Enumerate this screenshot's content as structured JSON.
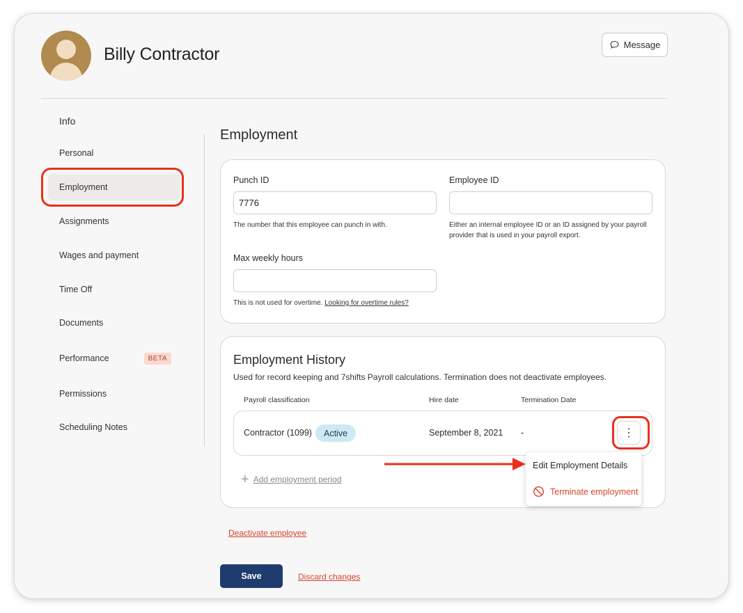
{
  "header": {
    "employee_name": "Billy Contractor",
    "message_label": "Message"
  },
  "sidebar": {
    "heading": "Info",
    "items": [
      {
        "label": "Personal"
      },
      {
        "label": "Employment",
        "active": true
      },
      {
        "label": "Assignments"
      },
      {
        "label": "Wages and payment"
      },
      {
        "label": "Time Off"
      },
      {
        "label": "Documents"
      },
      {
        "label": "Performance",
        "badge": "BETA"
      },
      {
        "label": "Permissions"
      },
      {
        "label": "Scheduling Notes"
      }
    ]
  },
  "employment": {
    "title": "Employment",
    "punch_id": {
      "label": "Punch ID",
      "value": "7776",
      "help": "The number that this employee can punch in with."
    },
    "employee_id": {
      "label": "Employee ID",
      "value": "",
      "help": "Either an internal employee ID or an ID assigned by your payroll provider that is used in your payroll export."
    },
    "max_weekly_hours": {
      "label": "Max weekly hours",
      "value": "",
      "help": "This is not used for overtime.",
      "help_link": "Looking for overtime rules?"
    }
  },
  "history": {
    "title": "Employment History",
    "description": "Used for record keeping and 7shifts Payroll calculations. Termination does not deactivate employees.",
    "columns": [
      "Payroll classification",
      "Hire date",
      "Termination Date"
    ],
    "rows": [
      {
        "classification": "Contractor (1099)",
        "status": "Active",
        "hire_date": "September 8, 2021",
        "termination_date": "-"
      }
    ],
    "add_period_label": "Add employment period",
    "menu": {
      "edit_label": "Edit Employment Details",
      "terminate_label": "Terminate employment"
    }
  },
  "footer": {
    "deactivate_label": "Deactivate employee",
    "save_label": "Save",
    "discard_label": "Discard changes"
  },
  "colors": {
    "primary": "#1f3c6e",
    "danger": "#d6452f",
    "annotation": "#e8301c",
    "status_pill": "#cfe9f3",
    "beta_badge": "#fbd9cf"
  }
}
